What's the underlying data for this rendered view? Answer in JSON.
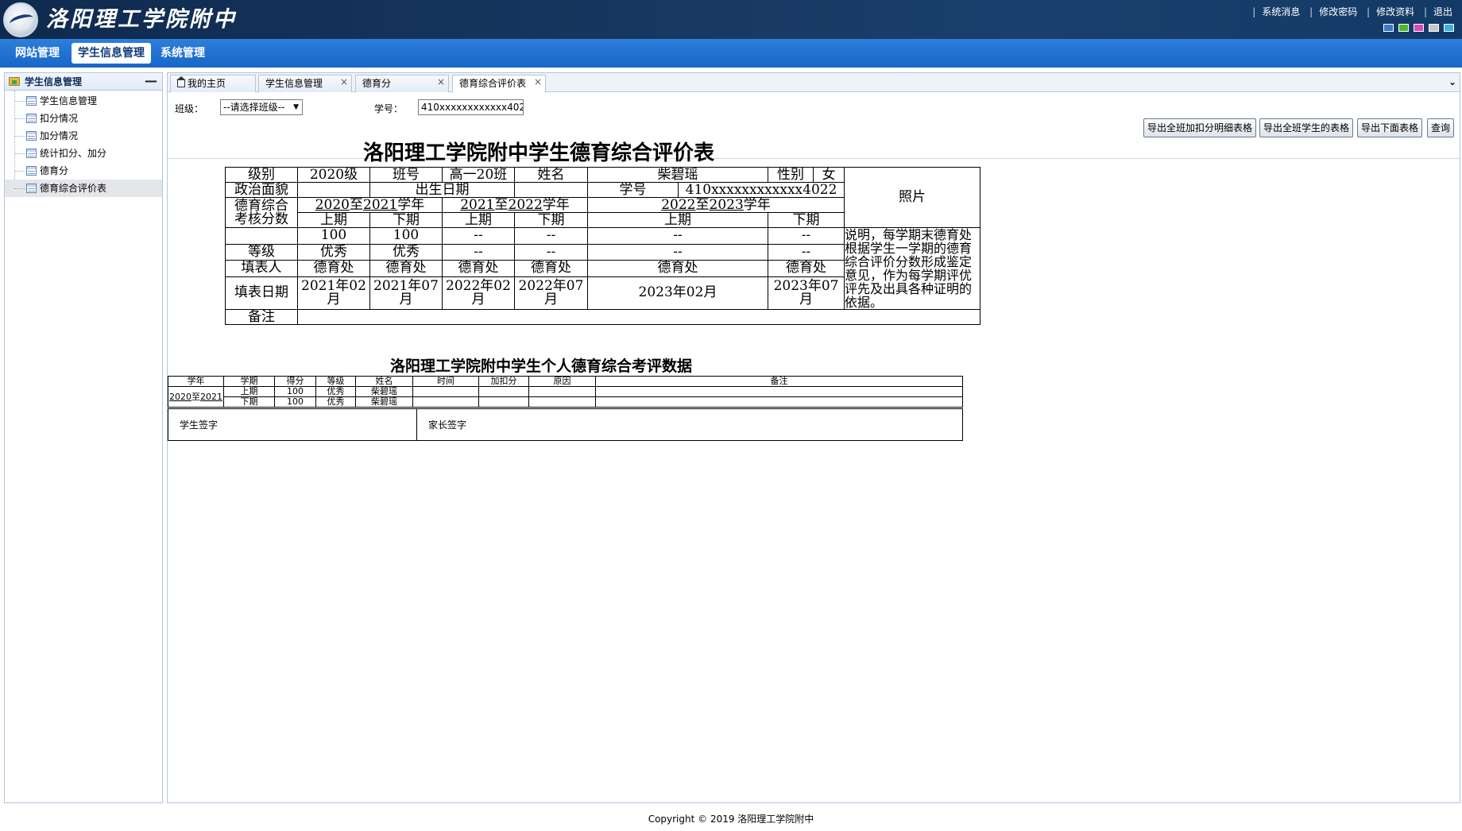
{
  "header": {
    "logo_text": "洛阳理工学院附中",
    "links": [
      "系统消息",
      "修改密码",
      "修改资料",
      "退出"
    ],
    "swatch_colors": [
      "#3a78c9",
      "#4cbb2b",
      "#d84ab8",
      "#c9c9c9",
      "#3ab3e0"
    ]
  },
  "nav": {
    "items": [
      "网站管理",
      "学生信息管理",
      "系统管理"
    ],
    "active": "学生信息管理"
  },
  "sidebar": {
    "title": "学生信息管理",
    "collapse": "—",
    "items": [
      "学生信息管理",
      "扣分情况",
      "加分情况",
      "统计扣分、加分",
      "德育分",
      "德育综合评价表"
    ],
    "selected": "德育综合评价表"
  },
  "tabs": {
    "items": [
      "我的主页",
      "学生信息管理",
      "德育分",
      "德育综合评价表"
    ],
    "active": "德育综合评价表",
    "close": "×",
    "menu": "⌄"
  },
  "filter": {
    "class_label": "班级：",
    "class_value": "--请选择班级--",
    "id_label": "学号：",
    "id_value": "410xxxxxxxxxxxx4022",
    "buttons": [
      "导出全班加扣分明细表格",
      "导出全班学生的表格",
      "导出下面表格",
      "查询"
    ]
  },
  "evaluation": {
    "title": "洛阳理工学院附中学生德育综合评价表",
    "labels": {
      "level": "级别",
      "class": "班号",
      "name": "姓名",
      "gender": "性别",
      "political": "政治面貌",
      "birth": "出生日期",
      "student_id": "学号",
      "score_label_1": "德育综合",
      "score_label_2": "考核分数",
      "grade": "等级",
      "filler": "填表人",
      "fill_date": "填表日期",
      "remark": "备注",
      "photo": "照片"
    },
    "values": {
      "level": "2020级",
      "class": "高一20班",
      "name": "柴碧瑶",
      "gender": "女",
      "political": "",
      "birth": "",
      "student_id": "410xxxxxxxxxxxx4022"
    },
    "years": [
      {
        "from": "2020",
        "mid": "至",
        "to": "2021",
        "suffix": "学年"
      },
      {
        "from": "2021",
        "mid": "至",
        "to": "2022",
        "suffix": "学年"
      },
      {
        "from": "2022",
        "mid": "至",
        "to": "2023",
        "suffix": "学年"
      }
    ],
    "terms": [
      "上期",
      "下期",
      "上期",
      "下期",
      "上期",
      "下期"
    ],
    "scores": [
      "100",
      "100",
      "--",
      "--",
      "--",
      "--"
    ],
    "grades": [
      "优秀",
      "优秀",
      "--",
      "--",
      "--",
      "--"
    ],
    "fillers": [
      "德育处",
      "德育处",
      "德育处",
      "德育处",
      "德育处",
      "德育处"
    ],
    "dates": [
      "2021年02月",
      "2021年07月",
      "2022年02月",
      "2022年07月",
      "2023年02月",
      "2023年07月"
    ],
    "note": "说明，每学期末德育处根据学生一学期的德育综合评价分数形成鉴定意见，作为每学期评优评先及出具各种证明的依据。"
  },
  "detail": {
    "title": "洛阳理工学院附中学生个人德育综合考评数据",
    "headers": [
      "学年",
      "学期",
      "得分",
      "等级",
      "姓名",
      "时间",
      "加扣分",
      "原因",
      "备注"
    ],
    "year": {
      "from": "2020",
      "mid": "至",
      "to": "2021"
    },
    "rows": [
      {
        "term": "上期",
        "score": "100",
        "grade": "优秀",
        "name": "柴碧瑶"
      },
      {
        "term": "下期",
        "score": "100",
        "grade": "优秀",
        "name": "柴碧瑶"
      }
    ],
    "sign_student": "学生签字",
    "sign_parent": "家长签字"
  },
  "footer": "Copyright © 2019 洛阳理工学院附中"
}
